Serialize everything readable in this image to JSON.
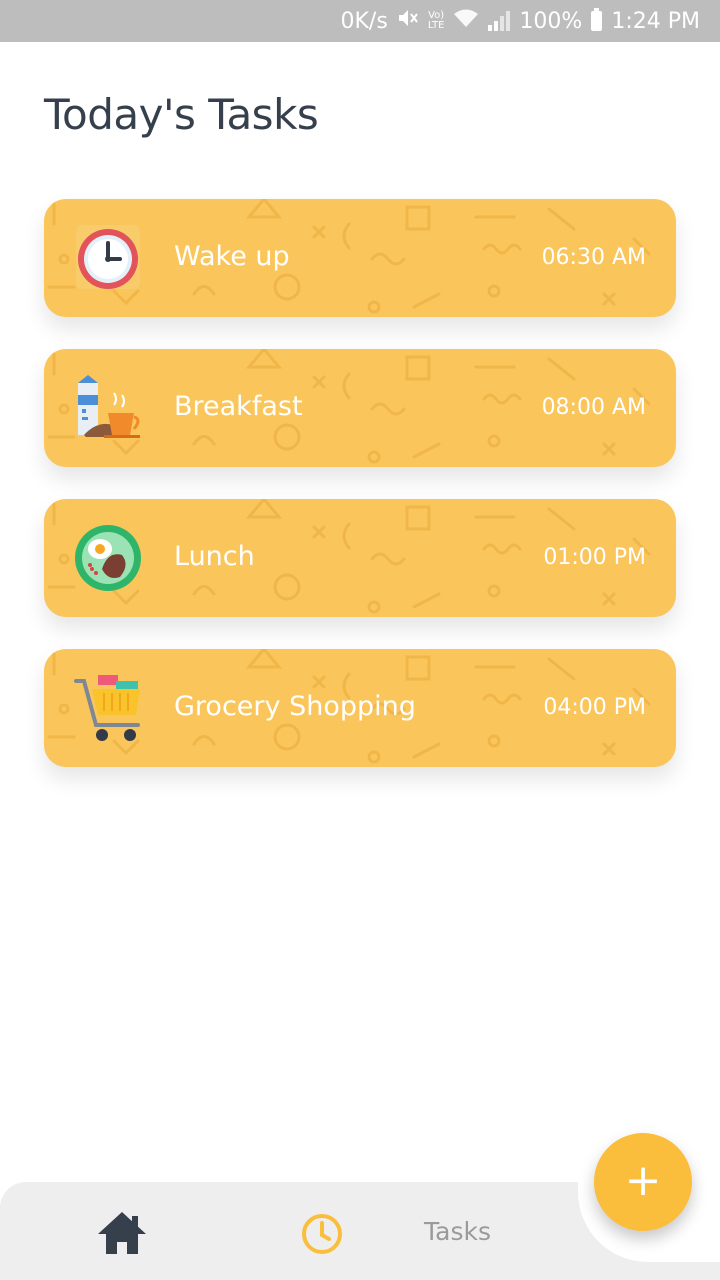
{
  "status_bar": {
    "speed": "0K/s",
    "volte": "Vo)",
    "lte": "LTE",
    "battery": "100%",
    "time": "1:24 PM"
  },
  "page": {
    "title": "Today's Tasks"
  },
  "tasks": [
    {
      "name": "Wake up",
      "time": "06:30 AM",
      "icon": "alarm-clock-icon"
    },
    {
      "name": "Breakfast",
      "time": "08:00 AM",
      "icon": "breakfast-icon"
    },
    {
      "name": "Lunch",
      "time": "01:00 PM",
      "icon": "lunch-plate-icon"
    },
    {
      "name": "Grocery Shopping",
      "time": "04:00 PM",
      "icon": "shopping-cart-icon"
    }
  ],
  "bottom_nav": {
    "home_icon": "home-icon",
    "tasks_icon": "clock-icon",
    "tasks_label": "Tasks"
  },
  "fab": {
    "label": "+",
    "icon": "add-icon"
  },
  "colors": {
    "card": "#fac65c",
    "accent": "#fbbd3c",
    "title": "#36404c",
    "nav_background": "#eeeeee"
  }
}
